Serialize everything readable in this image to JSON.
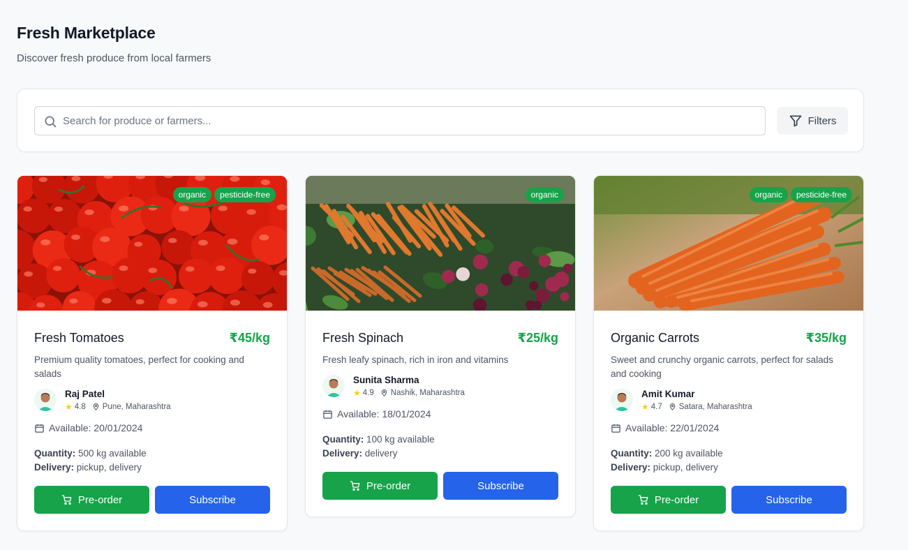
{
  "header": {
    "title": "Fresh Marketplace",
    "subtitle": "Discover fresh produce from local farmers"
  },
  "search": {
    "placeholder": "Search for produce or farmers...",
    "filters_label": "Filters"
  },
  "colors": {
    "accent_green": "#16a34a",
    "accent_blue": "#2563eb",
    "star": "#facc15"
  },
  "products": [
    {
      "name": "Fresh Tomatoes",
      "price": "₹45/kg",
      "tags": [
        "organic",
        "pesticide-free"
      ],
      "description": "Premium quality tomatoes, perfect for cooking and salads",
      "farmer": {
        "name": "Raj Patel",
        "rating": "4.8",
        "location": "Pune, Maharashtra"
      },
      "available": "Available: 20/01/2024",
      "quantity_label": "Quantity:",
      "quantity": " 500 kg available",
      "delivery_label": "Delivery:",
      "delivery": " pickup, delivery",
      "preorder_label": "Pre-order",
      "subscribe_label": "Subscribe"
    },
    {
      "name": "Fresh Spinach",
      "price": "₹25/kg",
      "tags": [
        "organic"
      ],
      "description": "Fresh leafy spinach, rich in iron and vitamins",
      "farmer": {
        "name": "Sunita Sharma",
        "rating": "4.9",
        "location": "Nashik, Maharashtra"
      },
      "available": "Available: 18/01/2024",
      "quantity_label": "Quantity:",
      "quantity": " 100 kg available",
      "delivery_label": "Delivery:",
      "delivery": " delivery",
      "preorder_label": "Pre-order",
      "subscribe_label": "Subscribe"
    },
    {
      "name": "Organic Carrots",
      "price": "₹35/kg",
      "tags": [
        "organic",
        "pesticide-free"
      ],
      "description": "Sweet and crunchy organic carrots, perfect for salads and cooking",
      "farmer": {
        "name": "Amit Kumar",
        "rating": "4.7",
        "location": "Satara, Maharashtra"
      },
      "available": "Available: 22/01/2024",
      "quantity_label": "Quantity:",
      "quantity": " 200 kg available",
      "delivery_label": "Delivery:",
      "delivery": " pickup, delivery",
      "preorder_label": "Pre-order",
      "subscribe_label": "Subscribe"
    }
  ],
  "icons": {
    "search": "search-icon",
    "filter": "filter-icon",
    "star": "star-icon",
    "pin": "map-pin-icon",
    "calendar": "calendar-icon",
    "cart": "cart-icon"
  }
}
